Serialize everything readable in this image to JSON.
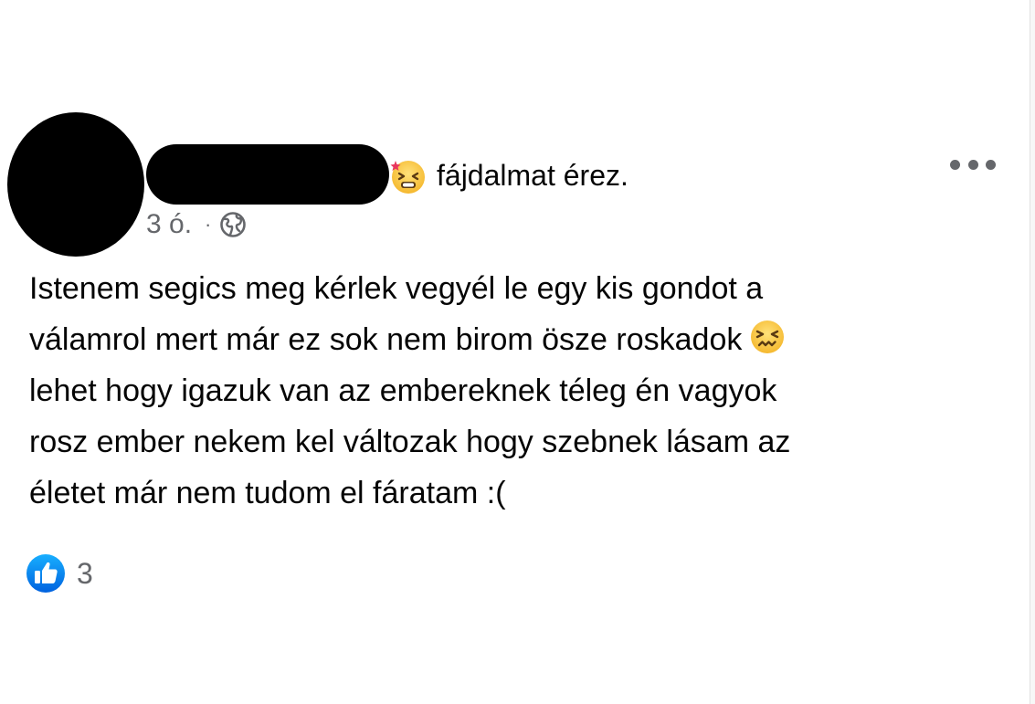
{
  "post": {
    "author_redacted": true,
    "feeling": {
      "icon": "pained-face-icon",
      "text": "fájdalmat érez."
    },
    "time": "3 ó.",
    "separator": "·",
    "privacy_icon": "globe-icon",
    "body_lines": [
      "Istenem segics meg kérlek vegyél le egy kis gondot a",
      "válamrol mert már ez sok nem birom ösze roskadok",
      "lehet hogy igazuk van az embereknek téleg én vagyok",
      "rosz ember nekem kel változak hogy szebnek lásam az",
      "életet már nem tudom el fáratam :("
    ],
    "inline_emoji": "confounded-face-icon",
    "reactions": {
      "icon": "like-icon",
      "count": "3"
    }
  },
  "colors": {
    "text": "#050505",
    "secondary": "#65676b",
    "like_blue": "#1877f2",
    "emoji_yellow": "#f7c23a"
  }
}
